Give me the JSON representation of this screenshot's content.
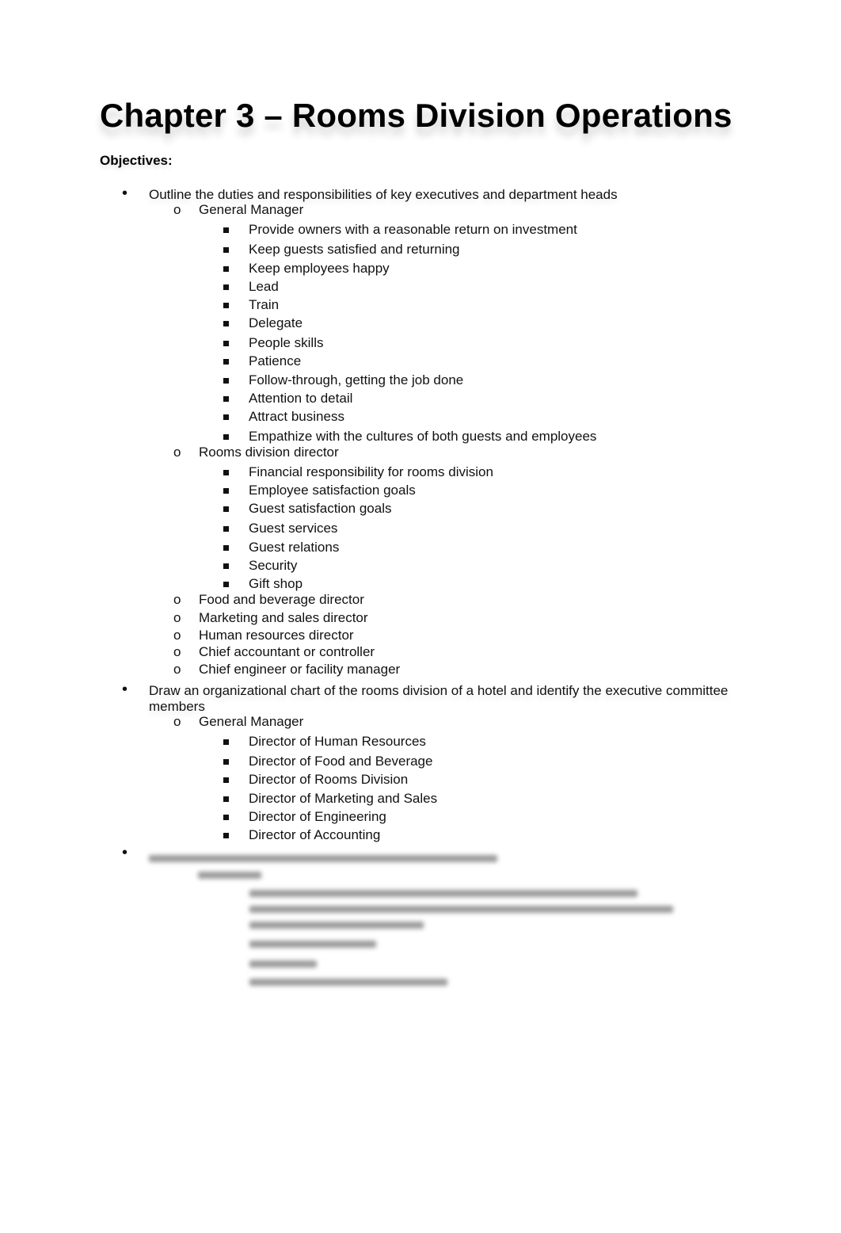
{
  "document": {
    "title": "Chapter 3 – Rooms Division Operations",
    "objectives_label": "Objectives:",
    "sections": [
      {
        "text": "Outline the duties and responsibilities of key executives and department heads",
        "items": [
          {
            "text": "General Manager",
            "items": [
              "Provide owners with a reasonable return on investment",
              "Keep guests satisfied and returning",
              "Keep employees happy",
              "Lead",
              "Train",
              "Delegate",
              "People skills",
              "Patience",
              "Follow-through, getting the job done",
              "Attention to detail",
              "Attract business",
              "Empathize with the cultures of both guests and employees"
            ]
          },
          {
            "text": "Rooms division director",
            "items": [
              "Financial responsibility for rooms division",
              "Employee satisfaction goals",
              "Guest satisfaction goals",
              "Guest services",
              "Guest relations",
              "Security",
              "Gift shop"
            ]
          },
          {
            "text": "Food and beverage director"
          },
          {
            "text": "Marketing and sales director"
          },
          {
            "text": "Human resources director"
          },
          {
            "text": "Chief accountant or controller"
          },
          {
            "text": "Chief engineer or facility manager"
          }
        ]
      },
      {
        "text_line1": "Draw an organizational chart of the rooms division of a hotel and identify the executive committee",
        "text_line2": "members",
        "items": [
          {
            "text": "General Manager",
            "items": [
              "Director of Human Resources",
              "Director of Food and Beverage",
              "Director of Rooms Division",
              "Director of Marketing and Sales",
              "Director of Engineering",
              "Director of Accounting"
            ]
          }
        ]
      }
    ],
    "blurred_section_note": "Remaining content is blurred and illegible"
  },
  "markers": {
    "level1": "•",
    "level2": "o"
  }
}
